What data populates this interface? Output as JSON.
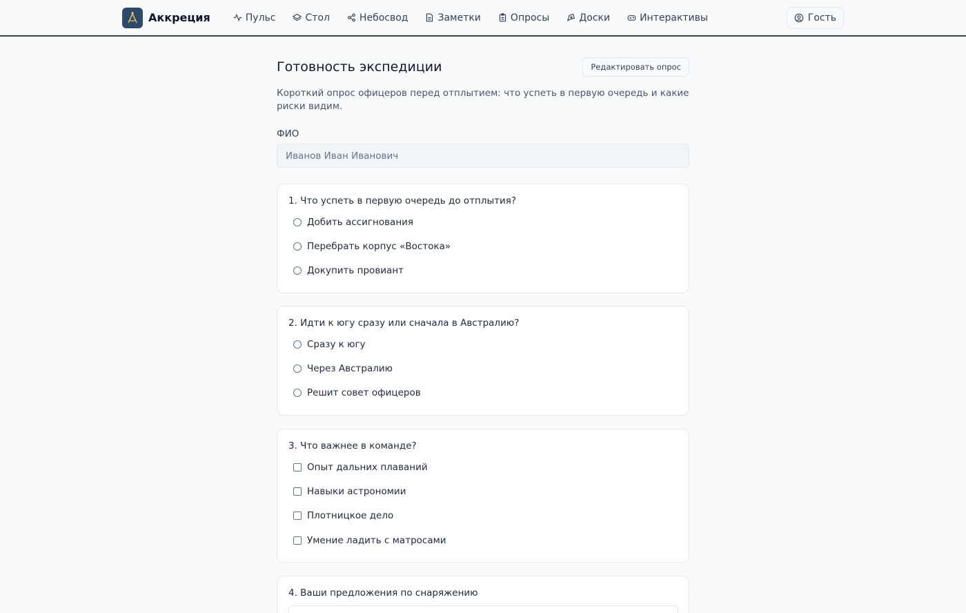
{
  "brand": {
    "name": "Аккреция"
  },
  "nav": {
    "items": [
      {
        "label": "Пульс",
        "icon": "activity-icon"
      },
      {
        "label": "Стол",
        "icon": "layers-icon"
      },
      {
        "label": "Небосвод",
        "icon": "share-nodes-icon"
      },
      {
        "label": "Заметки",
        "icon": "file-text-icon"
      },
      {
        "label": "Опросы",
        "icon": "clipboard-icon"
      },
      {
        "label": "Доски",
        "icon": "pen-tool-icon"
      },
      {
        "label": "Интерактивы",
        "icon": "gamepad-icon"
      }
    ]
  },
  "user": {
    "label": "Гость",
    "icon": "user-circle-icon"
  },
  "poll": {
    "title": "Готовность экспедиции",
    "edit_label": "Редактировать опрос",
    "description": "Короткий опрос офицеров перед отплытием: что успеть в первую очередь и какие риски видим.",
    "fio_label": "ФИО",
    "fio_placeholder": "Иванов Иван Иванович",
    "questions": [
      {
        "title": "1. Что успеть в первую очередь до отплытия?",
        "type": "radio",
        "options": [
          "Добить ассигнования",
          "Перебрать корпус «Востока»",
          "Докупить провиант"
        ]
      },
      {
        "title": "2. Идти к югу сразу или сначала в Австралию?",
        "type": "radio",
        "options": [
          "Сразу к югу",
          "Через Австралию",
          "Решит совет офицеров"
        ]
      },
      {
        "title": "3. Что важнее в команде?",
        "type": "checkbox",
        "options": [
          "Опыт дальних плаваний",
          "Навыки астрономии",
          "Плотницкое дело",
          "Умение ладить с матросами"
        ]
      },
      {
        "title": "4. Ваши предложения по снаряжению",
        "type": "text"
      }
    ]
  }
}
